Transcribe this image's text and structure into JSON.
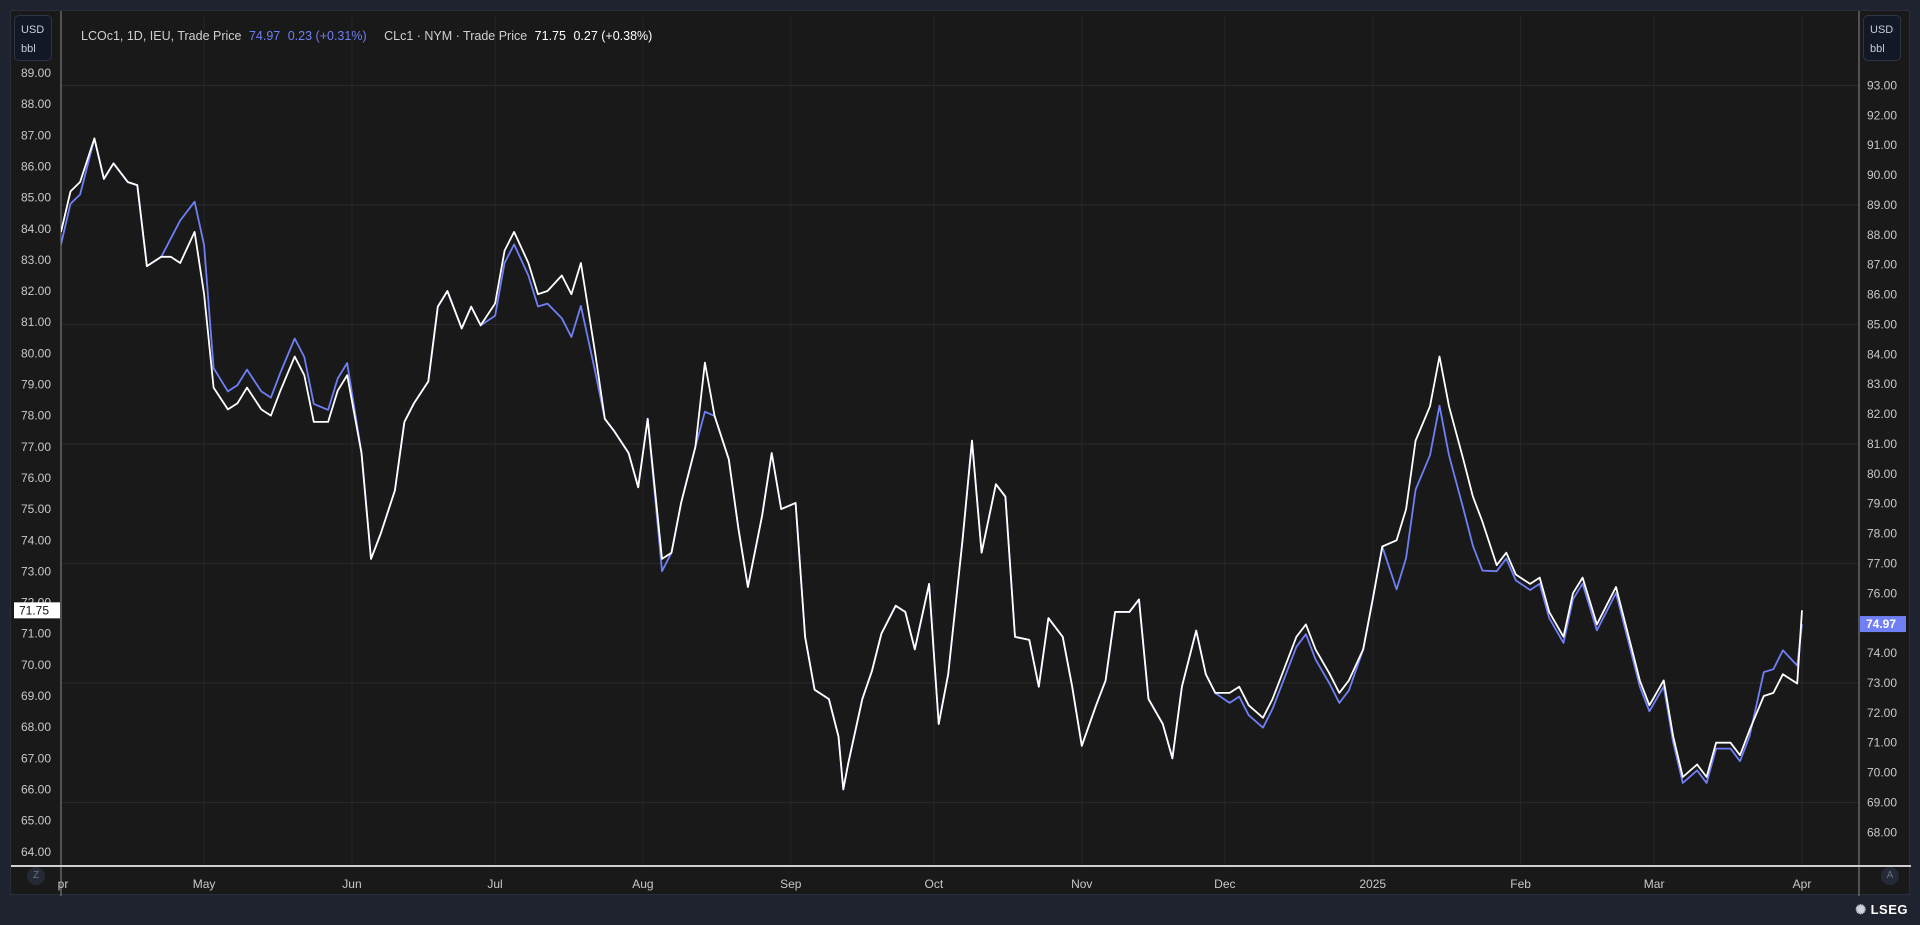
{
  "legend": {
    "series1": {
      "label": "LCOc1, 1D, IEU, Trade Price",
      "last": "74.97",
      "change": "0.23 (+0.31%)"
    },
    "series2": {
      "label": "CLc1 · NYM · Trade Price",
      "last": "71.75",
      "change": "0.27 (+0.38%)"
    }
  },
  "left_axis_unit": {
    "currency": "USD",
    "unit": "bbl"
  },
  "right_axis_unit": {
    "currency": "USD",
    "unit": "bbl"
  },
  "buttons": {
    "left": "Z",
    "right": "A"
  },
  "logo": "LSEG",
  "colors": {
    "brent": "#6f7ff5",
    "wti": "#ffffff",
    "background": "#191919",
    "frame": "#1f2330"
  },
  "chart_data": {
    "type": "line",
    "x_range": [
      "2024-04-01",
      "2025-04-01"
    ],
    "x_ticks": [
      {
        "date": "2024-04-01",
        "label": "Apr"
      },
      {
        "date": "2024-05-01",
        "label": "May"
      },
      {
        "date": "2024-06-01",
        "label": "Jun"
      },
      {
        "date": "2024-07-01",
        "label": "Jul"
      },
      {
        "date": "2024-08-01",
        "label": "Aug"
      },
      {
        "date": "2024-09-01",
        "label": "Sep"
      },
      {
        "date": "2024-10-01",
        "label": "Oct"
      },
      {
        "date": "2024-11-01",
        "label": "Nov"
      },
      {
        "date": "2024-12-01",
        "label": "Dec"
      },
      {
        "date": "2025-01-01",
        "label": "2025"
      },
      {
        "date": "2025-02-01",
        "label": "Feb"
      },
      {
        "date": "2025-03-01",
        "label": "Mar"
      },
      {
        "date": "2025-04-01",
        "label": "Apr"
      }
    ],
    "left_axis": {
      "ylim": [
        63.3,
        89.6
      ],
      "ticks": [
        89,
        88,
        87,
        86,
        85,
        84,
        83,
        82,
        81,
        80,
        79,
        78,
        77,
        76,
        75,
        74,
        73,
        72,
        71,
        70,
        69,
        68,
        67,
        66,
        65,
        64
      ],
      "series": "CLc1"
    },
    "right_axis": {
      "ylim": [
        67.3,
        93.6
      ],
      "ticks": [
        93,
        92,
        91,
        90,
        89,
        88,
        87,
        86,
        85,
        84,
        83,
        82,
        81,
        80,
        79,
        78,
        77,
        76,
        75,
        74,
        73,
        72,
        71,
        70,
        69,
        68
      ],
      "series": "LCOc1",
      "grid": [
        93,
        89,
        85,
        81,
        77,
        73,
        69
      ]
    },
    "grid": true,
    "dates": [
      "2024-04-01",
      "2024-04-03",
      "2024-04-05",
      "2024-04-08",
      "2024-04-10",
      "2024-04-12",
      "2024-04-15",
      "2024-04-17",
      "2024-04-19",
      "2024-04-22",
      "2024-04-24",
      "2024-04-26",
      "2024-04-29",
      "2024-05-01",
      "2024-05-03",
      "2024-05-06",
      "2024-05-08",
      "2024-05-10",
      "2024-05-13",
      "2024-05-15",
      "2024-05-17",
      "2024-05-20",
      "2024-05-22",
      "2024-05-24",
      "2024-05-27",
      "2024-05-29",
      "2024-05-31",
      "2024-06-03",
      "2024-06-05",
      "2024-06-07",
      "2024-06-10",
      "2024-06-12",
      "2024-06-14",
      "2024-06-17",
      "2024-06-19",
      "2024-06-21",
      "2024-06-24",
      "2024-06-26",
      "2024-06-28",
      "2024-07-01",
      "2024-07-03",
      "2024-07-05",
      "2024-07-08",
      "2024-07-10",
      "2024-07-12",
      "2024-07-15",
      "2024-07-17",
      "2024-07-19",
      "2024-07-22",
      "2024-07-24",
      "2024-07-26",
      "2024-07-29",
      "2024-07-31",
      "2024-08-02",
      "2024-08-05",
      "2024-08-07",
      "2024-08-09",
      "2024-08-12",
      "2024-08-14",
      "2024-08-16",
      "2024-08-19",
      "2024-08-21",
      "2024-08-23",
      "2024-08-26",
      "2024-08-28",
      "2024-08-30",
      "2024-09-02",
      "2024-09-04",
      "2024-09-06",
      "2024-09-09",
      "2024-09-11",
      "2024-09-12",
      "2024-09-13",
      "2024-09-16",
      "2024-09-18",
      "2024-09-20",
      "2024-09-23",
      "2024-09-25",
      "2024-09-27",
      "2024-09-30",
      "2024-10-02",
      "2024-10-04",
      "2024-10-07",
      "2024-10-09",
      "2024-10-11",
      "2024-10-14",
      "2024-10-16",
      "2024-10-18",
      "2024-10-21",
      "2024-10-23",
      "2024-10-25",
      "2024-10-28",
      "2024-10-30",
      "2024-11-01",
      "2024-11-04",
      "2024-11-06",
      "2024-11-08",
      "2024-11-11",
      "2024-11-13",
      "2024-11-15",
      "2024-11-18",
      "2024-11-20",
      "2024-11-22",
      "2024-11-25",
      "2024-11-27",
      "2024-11-29",
      "2024-12-02",
      "2024-12-04",
      "2024-12-06",
      "2024-12-09",
      "2024-12-11",
      "2024-12-13",
      "2024-12-16",
      "2024-12-18",
      "2024-12-20",
      "2024-12-23",
      "2024-12-25",
      "2024-12-27",
      "2024-12-30",
      "2025-01-01",
      "2025-01-03",
      "2025-01-06",
      "2025-01-08",
      "2025-01-10",
      "2025-01-13",
      "2025-01-15",
      "2025-01-17",
      "2025-01-20",
      "2025-01-22",
      "2025-01-24",
      "2025-01-27",
      "2025-01-29",
      "2025-01-31",
      "2025-02-03",
      "2025-02-05",
      "2025-02-07",
      "2025-02-10",
      "2025-02-12",
      "2025-02-14",
      "2025-02-17",
      "2025-02-19",
      "2025-02-21",
      "2025-02-24",
      "2025-02-26",
      "2025-02-28",
      "2025-03-03",
      "2025-03-05",
      "2025-03-07",
      "2025-03-10",
      "2025-03-12",
      "2025-03-14",
      "2025-03-17",
      "2025-03-19",
      "2025-03-21",
      "2025-03-24",
      "2025-03-26",
      "2025-03-28",
      "2025-03-31",
      "2025-04-01"
    ],
    "series": [
      {
        "name": "LCOc1",
        "axis": "right",
        "color": "#6f7ff5",
        "values": [
          87.68,
          89.04,
          89.35,
          91.22,
          89.87,
          90.39,
          89.76,
          89.66,
          86.95,
          87.26,
          87.87,
          88.48,
          89.11,
          87.65,
          83.54,
          82.76,
          82.97,
          83.49,
          82.76,
          82.55,
          83.39,
          84.53,
          83.91,
          82.34,
          82.14,
          83.19,
          83.71,
          80.69,
          77.15,
          77.98,
          79.44,
          81.73,
          82.36,
          83.09,
          85.59,
          86.11,
          84.86,
          85.59,
          84.97,
          85.29,
          87.06,
          87.68,
          86.64,
          85.6,
          85.7,
          85.21,
          84.58,
          85.62,
          83.42,
          81.84,
          81.42,
          80.69,
          79.55,
          81.84,
          76.74,
          77.36,
          79.02,
          80.9,
          82.08,
          81.94,
          80.48,
          78.19,
          76.21,
          78.61,
          80.69,
          78.82,
          79.02,
          74.54,
          72.77,
          72.46,
          71.2,
          69.43,
          70.27,
          72.46,
          73.39,
          74.65,
          75.58,
          75.37,
          74.12,
          76.31,
          71.62,
          73.29,
          77.77,
          81.11,
          77.36,
          79.65,
          79.23,
          74.54,
          74.44,
          72.87,
          75.17,
          74.54,
          72.87,
          70.89,
          72.25,
          73.08,
          75.37,
          75.37,
          75.79,
          72.46,
          71.62,
          70.47,
          72.87,
          74.75,
          73.29,
          72.66,
          72.33,
          72.54,
          71.92,
          71.5,
          72.13,
          72.96,
          74.21,
          74.63,
          73.79,
          72.96,
          72.33,
          72.75,
          74.12,
          75.79,
          77.56,
          76.13,
          77.18,
          79.47,
          80.62,
          82.28,
          80.62,
          78.84,
          77.59,
          76.76,
          76.74,
          77.16,
          76.43,
          76.11,
          76.32,
          75.17,
          74.34,
          75.8,
          76.32,
          74.76,
          75.38,
          76.01,
          74.13,
          72.88,
          72.05,
          72.88,
          71.0,
          69.65,
          70.07,
          69.65,
          70.8,
          70.8,
          70.38,
          71.21,
          73.36,
          73.46,
          74.09,
          73.58,
          74.97
        ]
      },
      {
        "name": "CLc1",
        "axis": "left",
        "color": "#ffffff",
        "values": [
          83.9,
          85.2,
          85.5,
          86.9,
          85.6,
          86.1,
          85.5,
          85.4,
          82.8,
          83.1,
          83.1,
          82.9,
          83.9,
          81.9,
          78.9,
          78.2,
          78.4,
          78.9,
          78.2,
          78.0,
          78.8,
          79.9,
          79.3,
          77.8,
          77.8,
          78.8,
          79.3,
          76.8,
          73.4,
          74.2,
          75.6,
          77.8,
          78.4,
          79.1,
          81.5,
          82.0,
          80.8,
          81.5,
          80.9,
          81.6,
          83.3,
          83.9,
          82.9,
          81.9,
          82.0,
          82.5,
          81.9,
          82.9,
          80.0,
          77.9,
          77.5,
          76.8,
          75.7,
          77.9,
          73.4,
          73.6,
          75.2,
          77.0,
          79.7,
          78.0,
          76.6,
          74.4,
          72.5,
          74.8,
          76.8,
          75.0,
          75.2,
          70.9,
          69.2,
          68.9,
          67.7,
          66.0,
          66.8,
          68.9,
          69.8,
          71.0,
          71.9,
          71.7,
          70.5,
          72.6,
          68.1,
          69.7,
          74.0,
          77.2,
          73.6,
          75.8,
          75.4,
          70.9,
          70.8,
          69.3,
          71.5,
          70.9,
          69.3,
          67.4,
          68.7,
          69.5,
          71.7,
          71.7,
          72.1,
          68.9,
          68.1,
          67.0,
          69.3,
          71.1,
          69.7,
          69.1,
          69.1,
          69.3,
          68.7,
          68.3,
          68.9,
          69.7,
          70.9,
          71.3,
          70.5,
          69.7,
          69.1,
          69.5,
          70.5,
          72.1,
          73.8,
          74.0,
          75.0,
          77.2,
          78.3,
          79.9,
          78.3,
          76.6,
          75.4,
          74.6,
          73.2,
          73.6,
          72.9,
          72.6,
          72.8,
          71.7,
          70.9,
          72.3,
          72.8,
          71.3,
          71.9,
          72.5,
          70.7,
          69.5,
          68.7,
          69.5,
          67.7,
          66.4,
          66.8,
          66.4,
          67.5,
          67.5,
          67.1,
          67.9,
          69.0,
          69.1,
          69.7,
          69.4,
          71.75
        ]
      }
    ],
    "last_labels": {
      "left": "71.75",
      "right": "74.97"
    }
  }
}
